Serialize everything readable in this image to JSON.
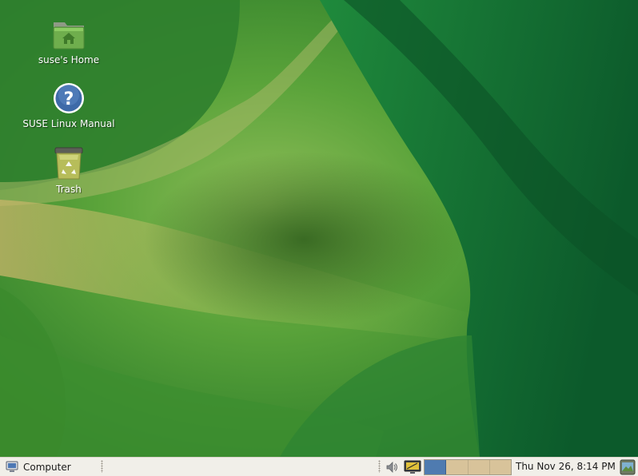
{
  "desktop": {
    "icons": [
      {
        "label": "suse's Home",
        "icon": "home-folder-icon"
      },
      {
        "label": "SUSE Linux Manual",
        "icon": "help-icon"
      },
      {
        "label": "Trash",
        "icon": "trash-icon"
      }
    ]
  },
  "panel": {
    "menu_label": "Computer",
    "menu_icon": "computer-icon",
    "tray_icons": [
      "volume-icon",
      "display-settings-icon"
    ],
    "workspaces": {
      "count": 4,
      "active_index": 0
    },
    "clock": "Thu Nov 26,  8:14 PM",
    "show_desktop_icon": "show-desktop-icon"
  },
  "colors": {
    "panel_bg": "#f1efe9",
    "wallpaper_base": "#3f8f2e",
    "workspace_active": "#4f7bb0",
    "workspace_inactive": "#d8c39a"
  }
}
